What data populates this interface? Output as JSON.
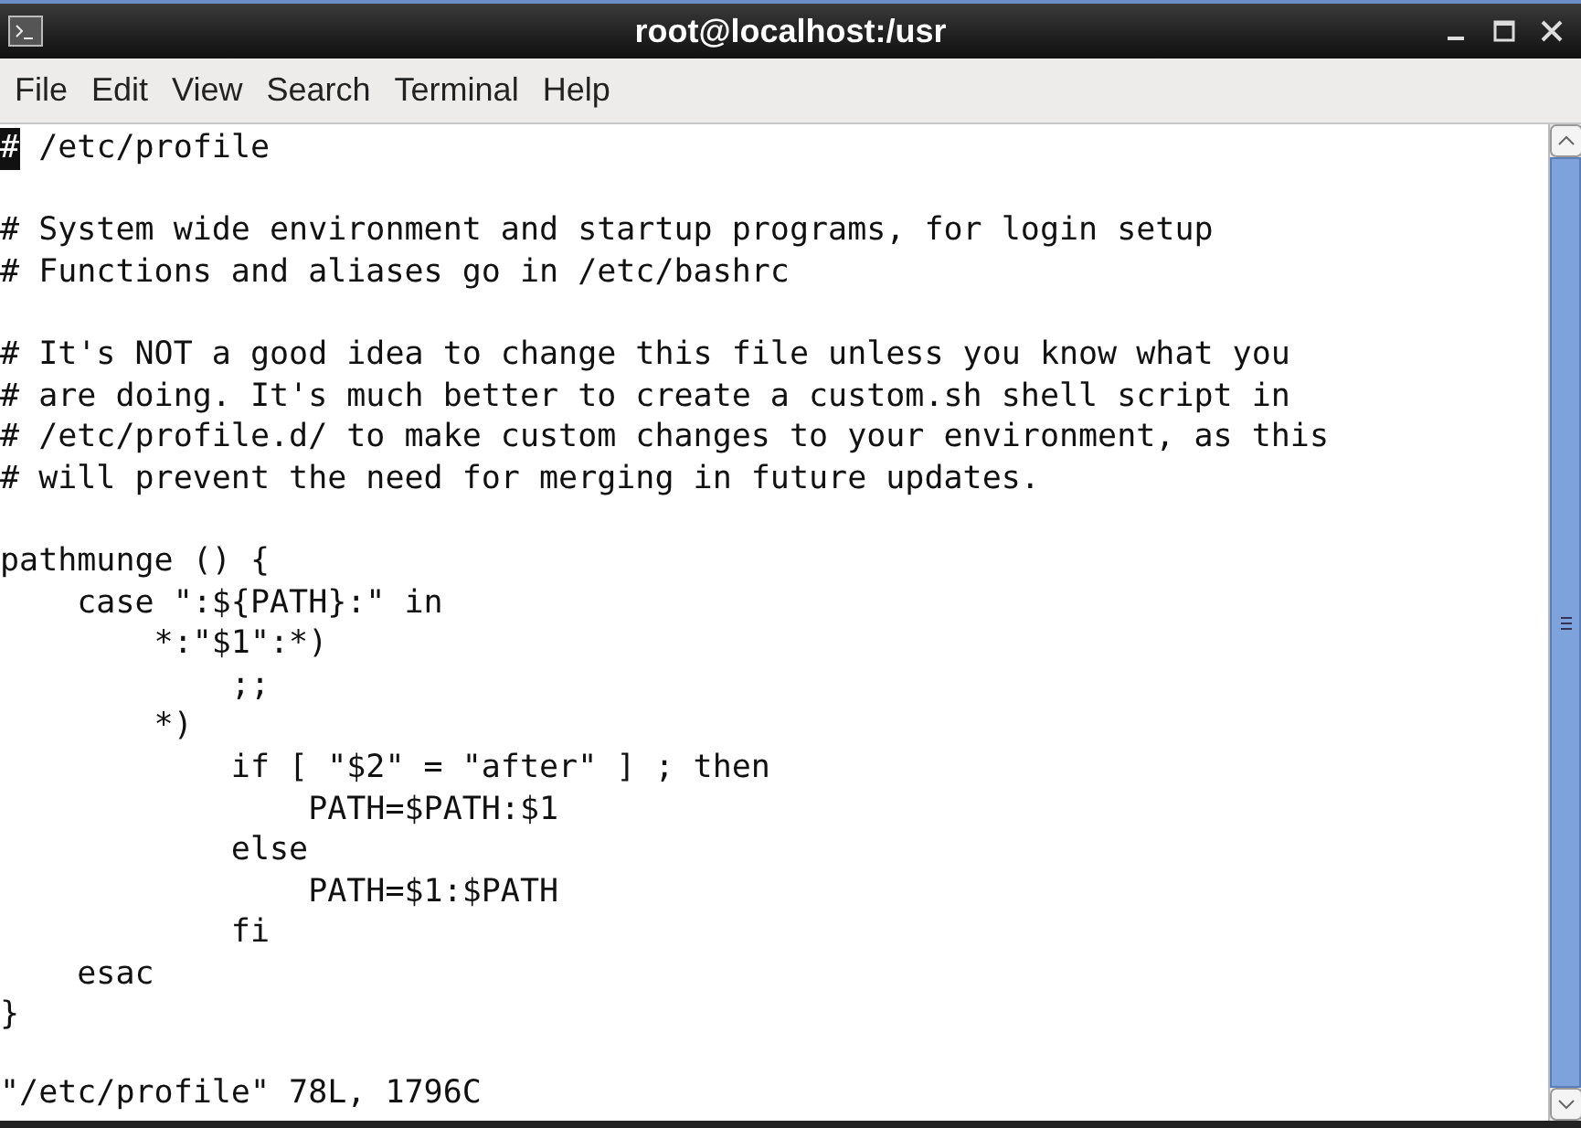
{
  "window": {
    "title": "root@localhost:/usr"
  },
  "menu": [
    "File",
    "Edit",
    "View",
    "Search",
    "Terminal",
    "Help"
  ],
  "terminal": {
    "blocks": [
      [
        {
          "cursor_text": "#",
          "text": " /etc/profile"
        }
      ],
      [
        {
          "text": "# System wide environment and startup programs, for login setup"
        },
        {
          "text": "# Functions and aliases go in /etc/bashrc"
        }
      ],
      [
        {
          "text": "# It's NOT a good idea to change this file unless you know what you"
        },
        {
          "text": "# are doing. It's much better to create a custom.sh shell script in"
        },
        {
          "text": "# /etc/profile.d/ to make custom changes to your environment, as this"
        },
        {
          "text": "# will prevent the need for merging in future updates."
        }
      ],
      [
        {
          "text": "pathmunge () {"
        },
        {
          "text": "    case \":${PATH}:\" in"
        },
        {
          "text": "        *:\"$1\":*)"
        },
        {
          "text": "            ;;"
        },
        {
          "text": "        *)"
        },
        {
          "text": "            if [ \"$2\" = \"after\" ] ; then"
        },
        {
          "text": "                PATH=$PATH:$1"
        },
        {
          "text": "            else"
        },
        {
          "text": "                PATH=$1:$PATH"
        },
        {
          "text": "            fi"
        },
        {
          "text": "    esac"
        },
        {
          "text": "}"
        }
      ]
    ],
    "status_line": "\"/etc/profile\" 78L, 1796C"
  }
}
